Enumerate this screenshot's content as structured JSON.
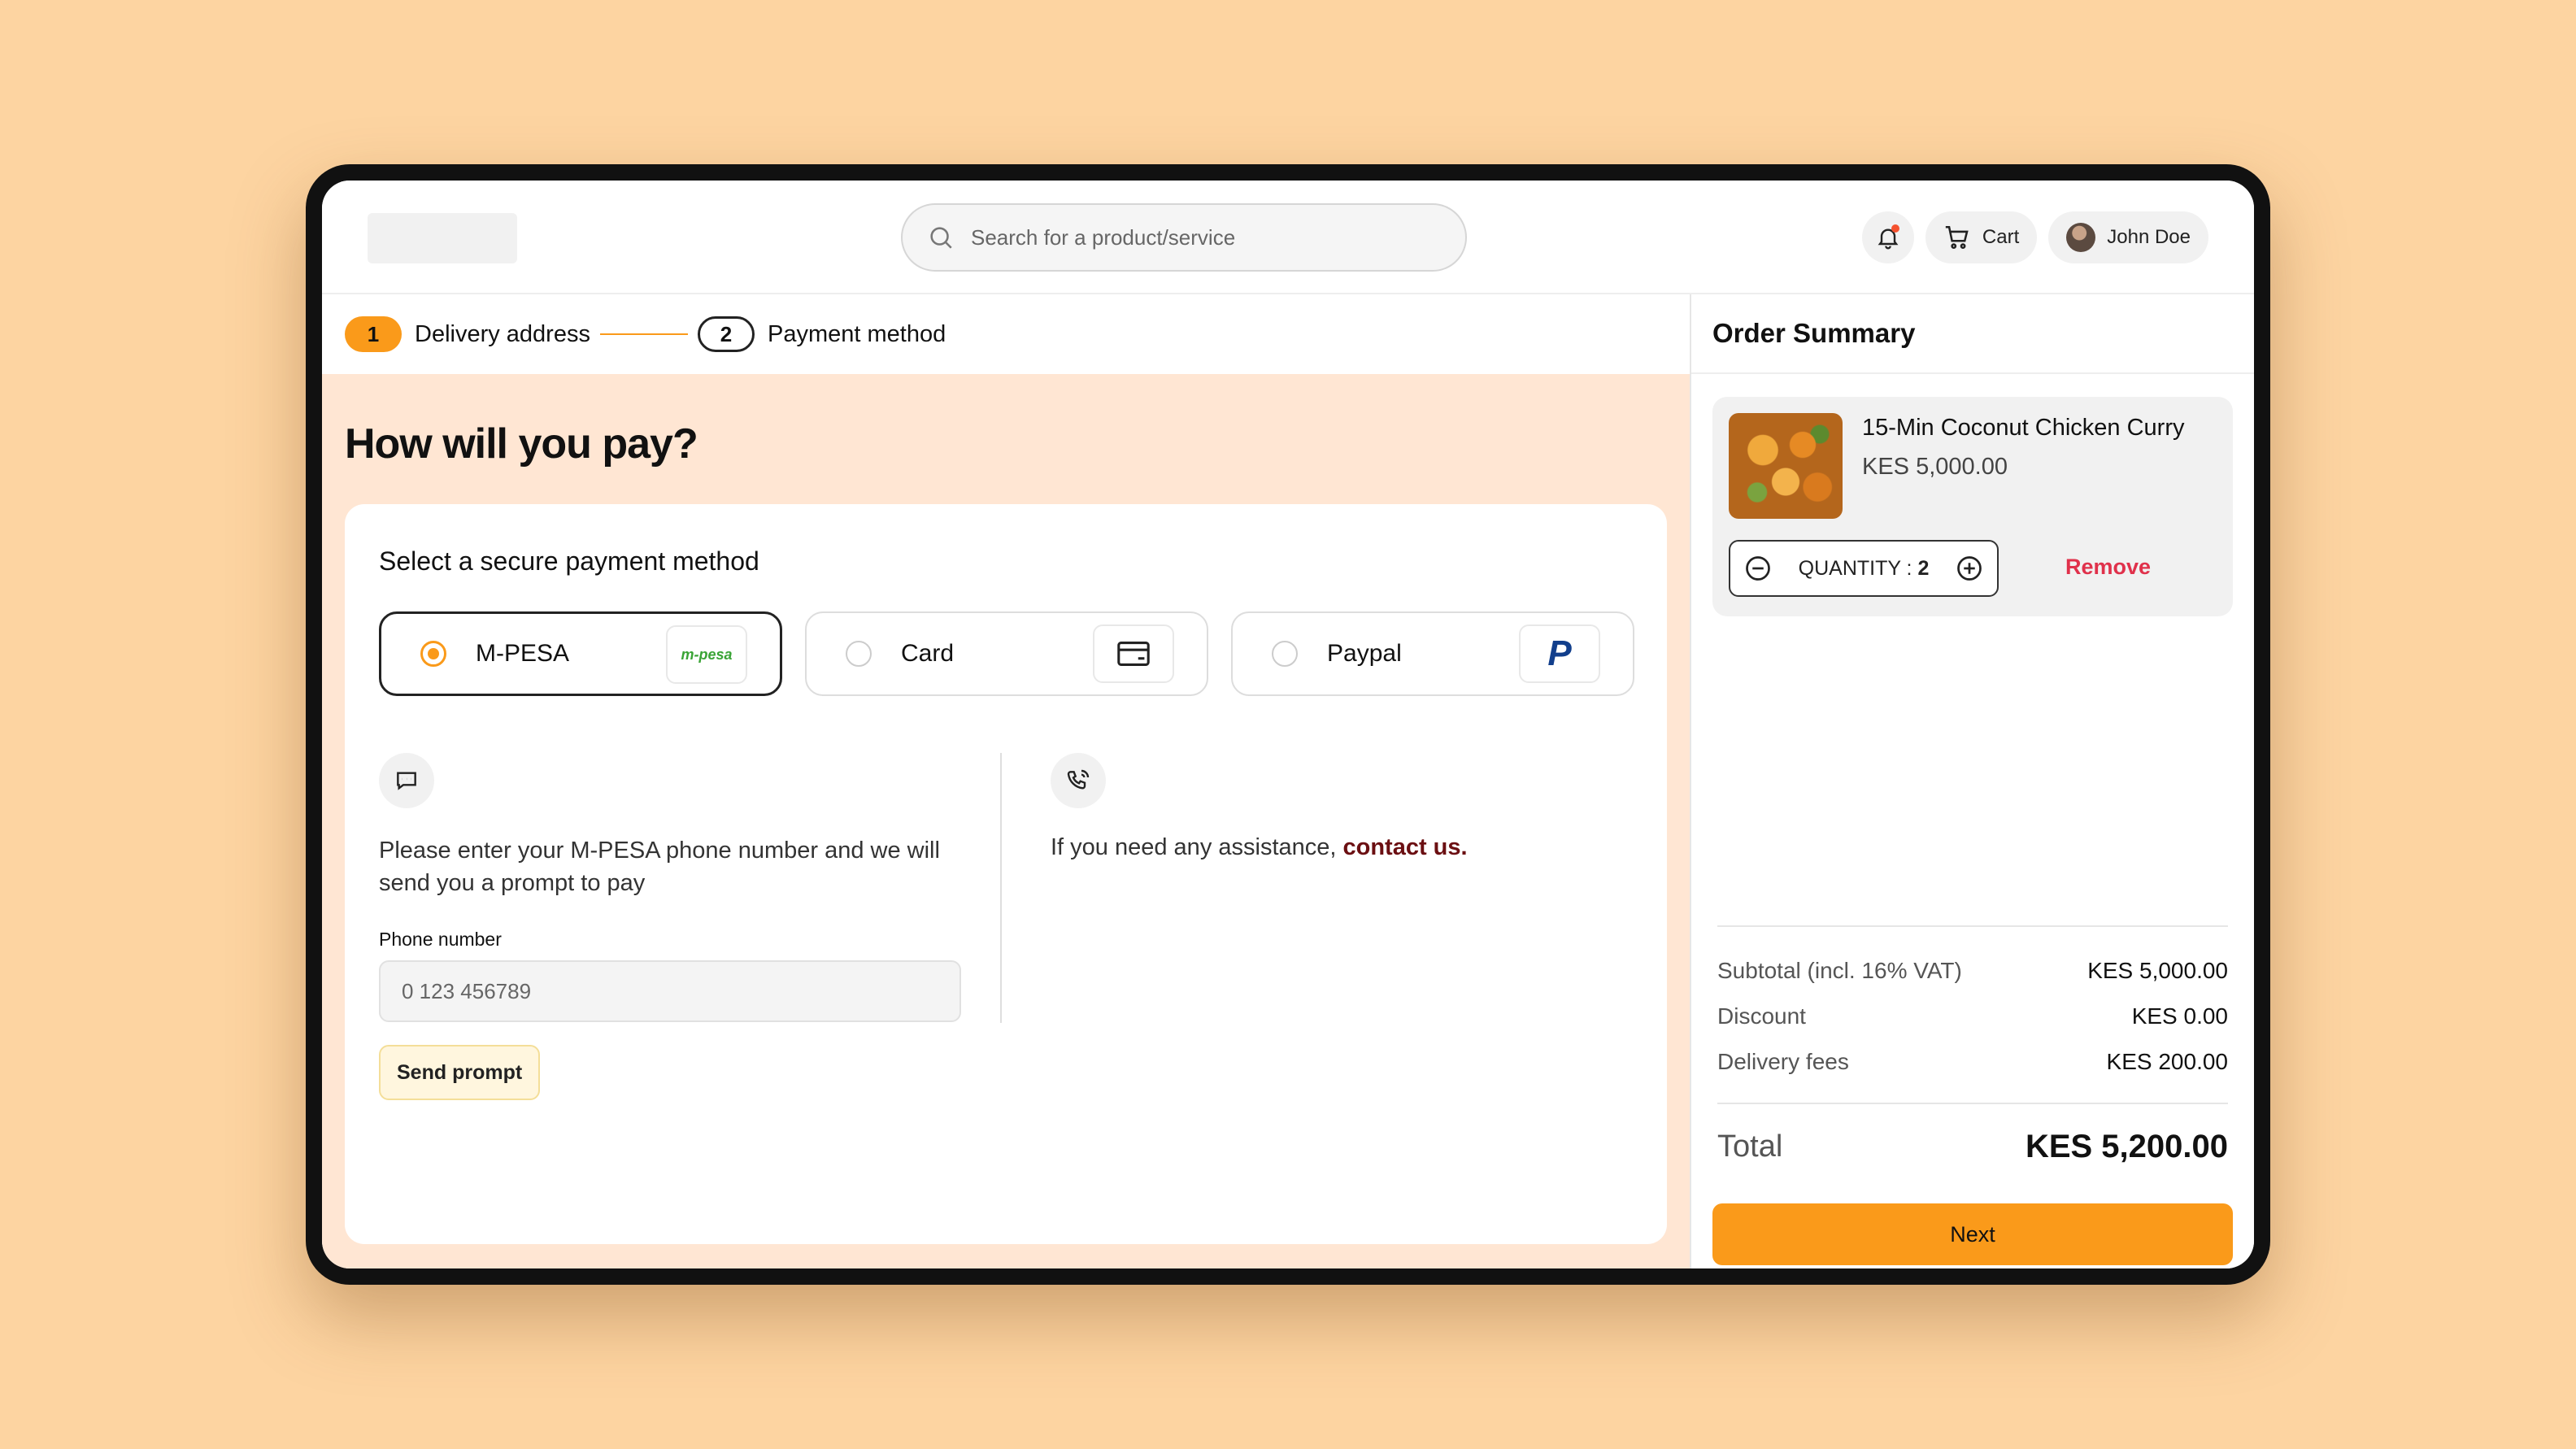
{
  "header": {
    "search_placeholder": "Search for a product/service",
    "cart_label": "Cart",
    "user_name": "John Doe",
    "icons": [
      "search-icon",
      "bell-icon",
      "cart-icon",
      "avatar"
    ]
  },
  "stepper": {
    "steps": [
      {
        "number": "1",
        "label": "Delivery address",
        "active": true
      },
      {
        "number": "2",
        "label": "Payment method",
        "active": false
      }
    ]
  },
  "payment": {
    "title": "How will you pay?",
    "subtitle": "Select a secure payment method",
    "methods": [
      {
        "label": "M-PESA",
        "logo_text": "m-pesa",
        "selected": true
      },
      {
        "label": "Card",
        "icon": "card-icon",
        "selected": false
      },
      {
        "label": "Paypal",
        "logo_text": "P",
        "selected": false
      }
    ],
    "mpesa_instructions": "Please enter your M-PESA phone number and we will send you a prompt to pay",
    "phone_label": "Phone number",
    "phone_placeholder": "0 123 456789",
    "send_prompt_label": "Send prompt",
    "assist_text": "If you need any assistance, ",
    "assist_link": "contact us."
  },
  "order_summary": {
    "title": "Order Summary",
    "item": {
      "name": "15-Min Coconut Chicken Curry",
      "price": "KES 5,000.00",
      "quantity_label": "QUANTITY : ",
      "quantity": "2",
      "remove_label": "Remove"
    },
    "rows": [
      {
        "label": "Subtotal (incl. 16% VAT)",
        "value": "KES 5,000.00"
      },
      {
        "label": "Discount",
        "value": "KES 0.00"
      },
      {
        "label": "Delivery fees",
        "value": "KES 200.00"
      }
    ],
    "total_label": "Total",
    "total_value": "KES 5,200.00",
    "next_label": "Next"
  },
  "colors": {
    "background": "#FDD4A1",
    "accent": "#FA9A1A",
    "pay_area": "#FFE6D3",
    "remove": "#E0314B",
    "link": "#6B0F12"
  }
}
